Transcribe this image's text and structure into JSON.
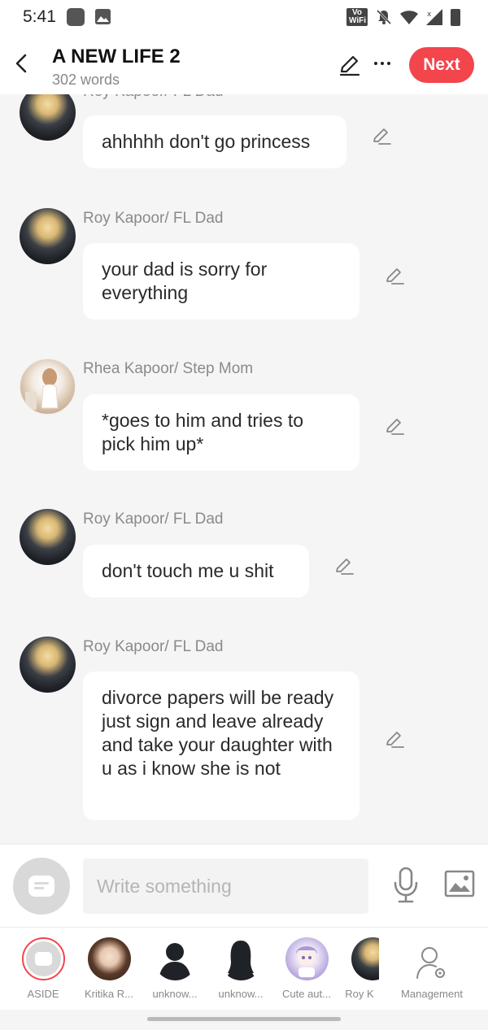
{
  "status_bar": {
    "time": "5:41",
    "wifi_label": "Vo WiFi"
  },
  "header": {
    "title": "A NEW LIFE 2",
    "word_count": "302 words",
    "next_label": "Next"
  },
  "messages": [
    {
      "speaker": "Roy Kapoor/ FL Dad",
      "text": "ahhhhh don't go princess",
      "avatar": "roy"
    },
    {
      "speaker": "Roy Kapoor/ FL Dad",
      "text": "your dad is sorry for everything",
      "avatar": "roy"
    },
    {
      "speaker": "Rhea Kapoor/ Step Mom",
      "text": "*goes to him and tries to pick him up*",
      "avatar": "rhea"
    },
    {
      "speaker": "Roy Kapoor/ FL Dad",
      "text": "don't touch me u shit",
      "avatar": "roy"
    },
    {
      "speaker": "Roy Kapoor/ FL Dad",
      "text": "divorce papers will be ready just sign and leave already and take your daughter with u as i know she is not",
      "avatar": "roy"
    }
  ],
  "composer": {
    "placeholder": "Write something"
  },
  "characters": [
    {
      "label": "ASIDE",
      "avatar": "aside-icon"
    },
    {
      "label": "Kritika R...",
      "avatar": "kritika"
    },
    {
      "label": "unknow...",
      "avatar": "male-silhouette"
    },
    {
      "label": "unknow...",
      "avatar": "female-silhouette"
    },
    {
      "label": "Cute aut...",
      "avatar": "cute"
    },
    {
      "label": "Roy K",
      "avatar": "roy"
    }
  ],
  "management_label": "Management",
  "colors": {
    "accent": "#f2454c",
    "background": "#f5f5f5",
    "bubble": "#ffffff"
  }
}
